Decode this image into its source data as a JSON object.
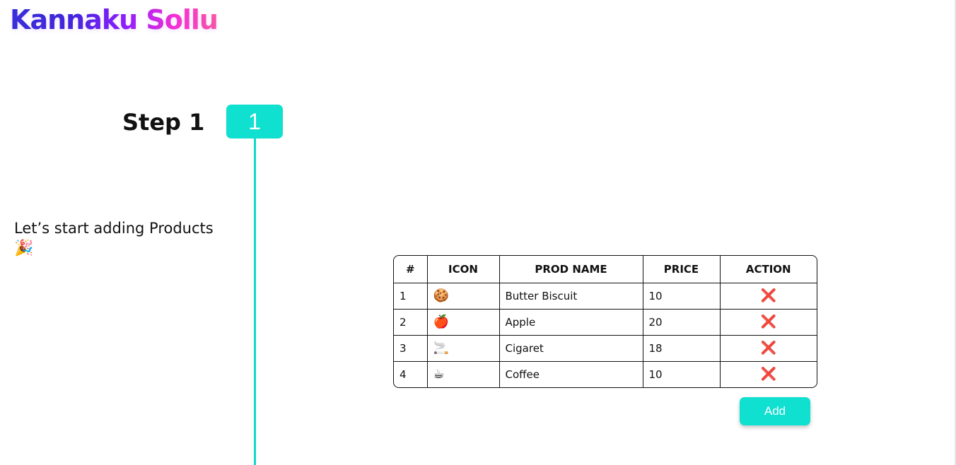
{
  "header": {
    "logo_text": "Kannaku Sollu"
  },
  "step": {
    "title": "Step 1",
    "number": "1"
  },
  "intro": {
    "text": "Let’s start adding Products",
    "emoji": "🎉"
  },
  "table": {
    "columns": [
      "#",
      "ICON",
      "PROD NAME",
      "PRICE",
      "ACTION"
    ],
    "rows": [
      {
        "num": "1",
        "icon": "🍪",
        "name": "Butter Biscuit",
        "price": "10",
        "action": "❌"
      },
      {
        "num": "2",
        "icon": "🍎",
        "name": "Apple",
        "price": "20",
        "action": "❌"
      },
      {
        "num": "3",
        "icon": "🚬",
        "name": "Cigaret",
        "price": "18",
        "action": "❌"
      },
      {
        "num": "4",
        "icon": "☕",
        "name": "Coffee",
        "price": "10",
        "action": "❌"
      }
    ]
  },
  "add_button": {
    "label": "Add"
  },
  "colors": {
    "accent": "#0fe0d0",
    "delete": "#d8241f"
  }
}
